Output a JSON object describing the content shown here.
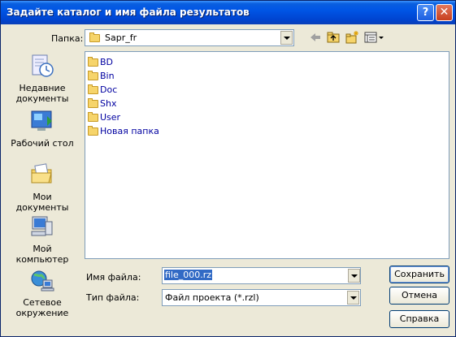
{
  "title": "Задайте каталог и имя файла результатов",
  "title_buttons": {
    "help": "?",
    "close": "✕"
  },
  "toolbar": {
    "folder_label": "Папка:",
    "folder_value": "Sapr_fr",
    "icons": [
      "back-arrow-icon",
      "up-folder-icon",
      "new-folder-icon",
      "view-menu-icon"
    ]
  },
  "places": [
    {
      "name": "recent",
      "label_line1": "Недавние",
      "label_line2": "документы",
      "icon": "recent-documents-icon"
    },
    {
      "name": "desktop",
      "label_line1": "Рабочий стол",
      "label_line2": "",
      "icon": "desktop-icon"
    },
    {
      "name": "my-documents",
      "label_line1": "Мои документы",
      "label_line2": "",
      "icon": "my-documents-icon"
    },
    {
      "name": "my-computer",
      "label_line1": "Мой компьютер",
      "label_line2": "",
      "icon": "my-computer-icon"
    },
    {
      "name": "network",
      "label_line1": "Сетевое",
      "label_line2": "окружение",
      "icon": "network-icon"
    }
  ],
  "files": [
    "BD",
    "Bin",
    "Doc",
    "Shx",
    "User",
    "Новая папка"
  ],
  "filename": {
    "label": "Имя файла:",
    "value": "file_000.rz"
  },
  "filetype": {
    "label": "Тип файла:",
    "value": "Файл проекта (*.rzl)"
  },
  "buttons": {
    "save": "Сохранить",
    "cancel": "Отмена",
    "help": "Справка"
  },
  "colors": {
    "titlebar": "#0055e5",
    "dialog_bg": "#ece9d8",
    "folder_text": "#0000a0",
    "selection": "#316ac5"
  }
}
